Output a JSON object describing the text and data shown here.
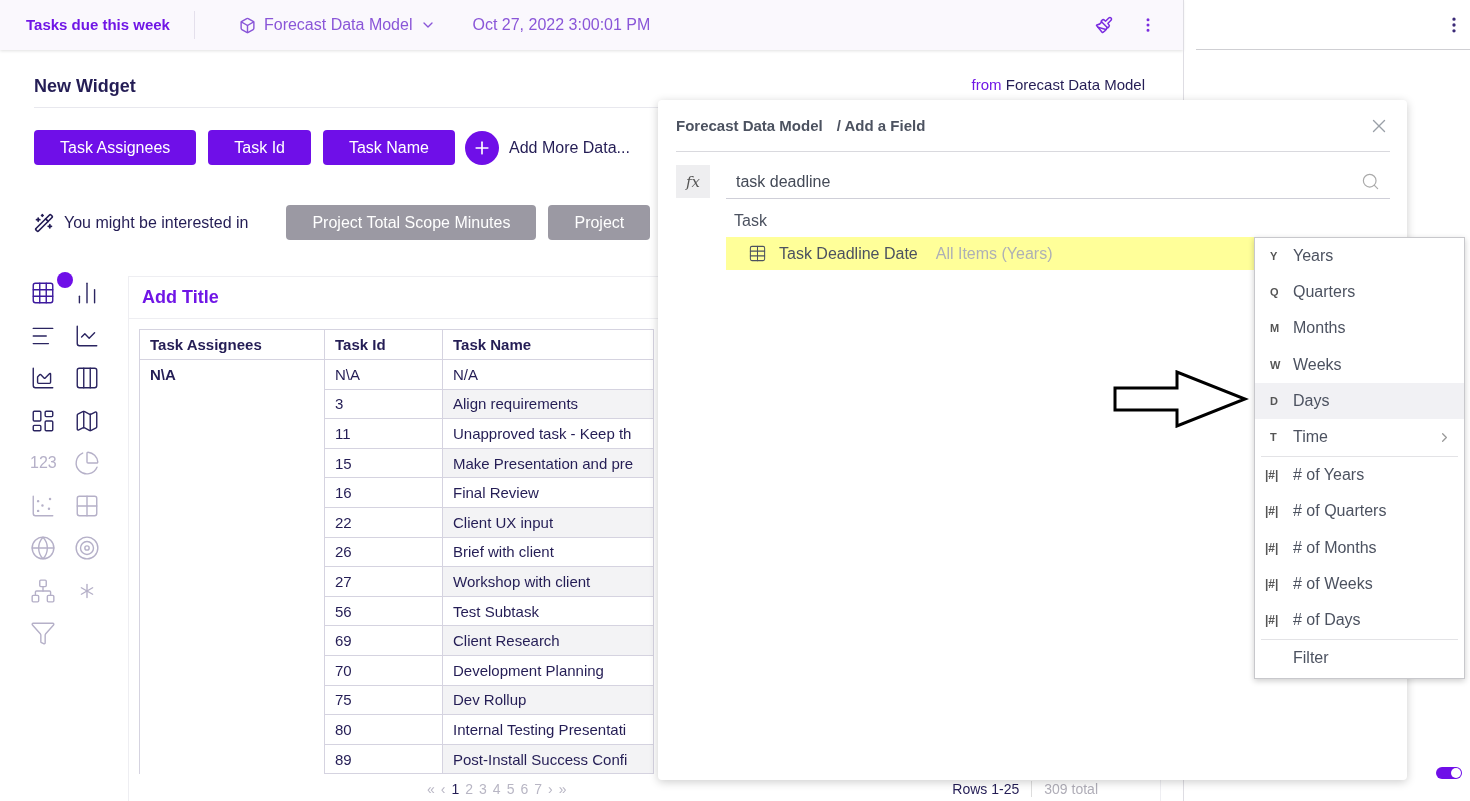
{
  "top_bar": {
    "title": "Tasks due this week",
    "model": "Forecast Data Model",
    "date": "Oct 27, 2022 3:00:01 PM"
  },
  "widget": {
    "title": "New Widget",
    "source_prefix": "from",
    "source": "Forecast Data Model",
    "fields": [
      "Task Assignees",
      "Task Id",
      "Task Name"
    ],
    "add_more": "Add More Data...",
    "suggest_label": "You might be interested in",
    "suggestions": [
      "Project Total Scope Minutes",
      "Project"
    ]
  },
  "chart_types": [
    {
      "selected": true,
      "disabled": false
    },
    {
      "selected": false,
      "disabled": false
    },
    {
      "selected": false,
      "disabled": false
    },
    {
      "selected": false,
      "disabled": false
    },
    {
      "selected": false,
      "disabled": false
    },
    {
      "selected": false,
      "disabled": false
    },
    {
      "selected": false,
      "disabled": false
    },
    {
      "selected": false,
      "disabled": false
    },
    {
      "label": "123",
      "selected": false,
      "disabled": true
    },
    {
      "selected": false,
      "disabled": true
    },
    {
      "selected": false,
      "disabled": true
    },
    {
      "selected": false,
      "disabled": true
    },
    {
      "selected": false,
      "disabled": true
    },
    {
      "selected": false,
      "disabled": true
    },
    {
      "selected": false,
      "disabled": true
    },
    {
      "selected": false,
      "disabled": true
    },
    {
      "selected": false,
      "disabled": true
    }
  ],
  "card": {
    "title": "Add Title",
    "table": {
      "columns": [
        "Task Assignees",
        "Task Id",
        "Task Name"
      ],
      "rows": [
        [
          "N\\A",
          "N\\A",
          "N/A"
        ],
        [
          "",
          "3",
          "Align requirements"
        ],
        [
          "",
          "11",
          "Unapproved task - Keep th"
        ],
        [
          "",
          "15",
          "Make Presentation and pre"
        ],
        [
          "",
          "16",
          "Final Review"
        ],
        [
          "",
          "22",
          "Client UX input"
        ],
        [
          "",
          "26",
          "Brief with client"
        ],
        [
          "",
          "27",
          "Workshop with client"
        ],
        [
          "",
          "56",
          "Test Subtask"
        ],
        [
          "",
          "69",
          "Client Research"
        ],
        [
          "",
          "70",
          "Development Planning"
        ],
        [
          "",
          "75",
          "Dev Rollup"
        ],
        [
          "",
          "80",
          "Internal Testing Presentati"
        ],
        [
          "",
          "89",
          "Post-Install Success Confi"
        ]
      ]
    },
    "pagination": {
      "first": "«",
      "prev": "‹",
      "pages": [
        {
          "label": "1",
          "selected": true
        },
        {
          "label": "2",
          "selected": false
        },
        {
          "label": "3",
          "selected": false
        },
        {
          "label": "4",
          "selected": false
        },
        {
          "label": "5",
          "selected": false
        },
        {
          "label": "6",
          "selected": false
        },
        {
          "label": "7",
          "selected": false
        }
      ],
      "next": "›",
      "last": "»"
    },
    "rows_info": "Rows 1-25",
    "total": "309 total"
  },
  "right_panel": {
    "toggle": {
      "on": true
    }
  },
  "dialog": {
    "model": "Forecast Data Model",
    "crumb": "/ Add a Field",
    "fx": "fx",
    "search": {
      "value": "task deadline"
    },
    "group": "Task",
    "results": [
      {
        "name": "Task Deadline Date",
        "detail": "All Items (Years)",
        "selected": true
      }
    ]
  },
  "menu": {
    "groups": [
      [
        {
          "kind": "letter",
          "badge": "Y",
          "label": "Years",
          "selected": false,
          "submenu": false
        },
        {
          "kind": "letter",
          "badge": "Q",
          "label": "Quarters",
          "selected": false,
          "submenu": false
        },
        {
          "kind": "letter",
          "badge": "M",
          "label": "Months",
          "selected": false,
          "submenu": false
        },
        {
          "kind": "letter",
          "badge": "W",
          "label": "Weeks",
          "selected": false,
          "submenu": false
        },
        {
          "kind": "letter",
          "badge": "D",
          "label": "Days",
          "selected": true,
          "submenu": false
        },
        {
          "kind": "letter",
          "badge": "T",
          "label": "Time",
          "selected": false,
          "submenu": true
        }
      ],
      [
        {
          "kind": "count",
          "badge": "|#|",
          "label": "# of Years",
          "selected": false,
          "submenu": false
        },
        {
          "kind": "count",
          "badge": "|#|",
          "label": "# of Quarters",
          "selected": false,
          "submenu": false
        },
        {
          "kind": "count",
          "badge": "|#|",
          "label": "# of Months",
          "selected": false,
          "submenu": false
        },
        {
          "kind": "count",
          "badge": "|#|",
          "label": "# of Weeks",
          "selected": false,
          "submenu": false
        },
        {
          "kind": "count",
          "badge": "|#|",
          "label": "# of Days",
          "selected": false,
          "submenu": false
        }
      ],
      [
        {
          "kind": "plain",
          "label": "Filter",
          "selected": false,
          "submenu": false
        }
      ]
    ]
  }
}
